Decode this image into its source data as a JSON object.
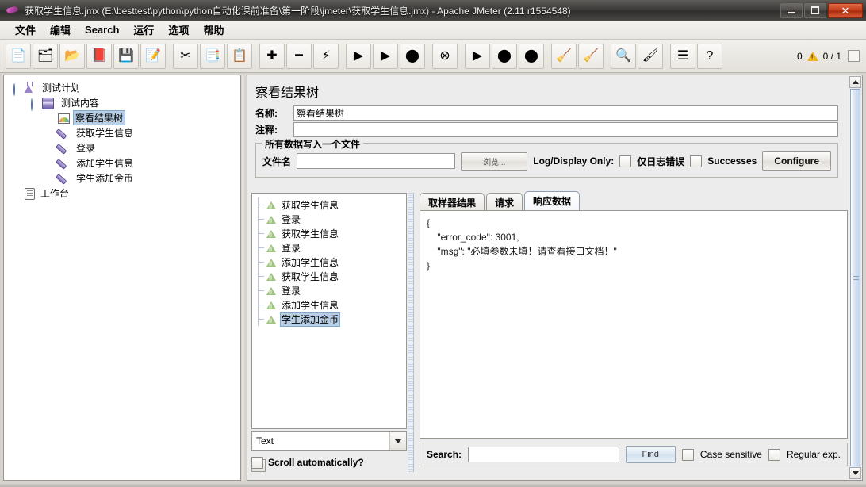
{
  "window": {
    "title": "获取学生信息.jmx (E:\\besttest\\python\\python自动化课前准备\\第一阶段\\jmeter\\获取学生信息.jmx) - Apache JMeter (2.11 r1554548)",
    "minimize_label": "—",
    "maximize_label": "□",
    "close_label": "✕"
  },
  "menubar": {
    "items": [
      {
        "label": "文件",
        "name": "menu-file"
      },
      {
        "label": "编辑",
        "name": "menu-edit"
      },
      {
        "label": "Search",
        "name": "menu-search"
      },
      {
        "label": "运行",
        "name": "menu-run"
      },
      {
        "label": "选项",
        "name": "menu-options"
      },
      {
        "label": "帮助",
        "name": "menu-help"
      }
    ]
  },
  "toolbar": {
    "buttons": [
      {
        "icon": "new-file-icon",
        "glyph": "📄"
      },
      {
        "icon": "templates-icon",
        "glyph": "🗂"
      },
      {
        "icon": "open-icon",
        "glyph": "📂"
      },
      {
        "icon": "close-icon",
        "glyph": "📕"
      },
      {
        "icon": "save-icon",
        "glyph": "💾"
      },
      {
        "icon": "save-as-icon",
        "glyph": "📝"
      },
      {
        "icon": "cut-icon",
        "glyph": "✂"
      },
      {
        "icon": "copy-icon",
        "glyph": "📑"
      },
      {
        "icon": "paste-icon",
        "glyph": "📋"
      },
      {
        "icon": "expand-icon",
        "glyph": "✚"
      },
      {
        "icon": "collapse-icon",
        "glyph": "━"
      },
      {
        "icon": "toggle-icon",
        "glyph": "⚡"
      },
      {
        "icon": "start-icon",
        "glyph": "▶"
      },
      {
        "icon": "start-no-pauses-icon",
        "glyph": "▶"
      },
      {
        "icon": "stop-icon",
        "glyph": "⬤"
      },
      {
        "icon": "shutdown-icon",
        "glyph": "⊗"
      },
      {
        "icon": "remote-start-icon",
        "glyph": "▶"
      },
      {
        "icon": "remote-stop-icon",
        "glyph": "⬤"
      },
      {
        "icon": "remote-shutdown-icon",
        "glyph": "⬤"
      },
      {
        "icon": "clear-icon",
        "glyph": "🧹"
      },
      {
        "icon": "clear-all-icon",
        "glyph": "🧹"
      },
      {
        "icon": "search-icon",
        "glyph": "🔍"
      },
      {
        "icon": "search-reset-icon",
        "glyph": "🖌"
      },
      {
        "icon": "function-helper-icon",
        "glyph": "☰"
      },
      {
        "icon": "help-icon",
        "glyph": "?"
      }
    ],
    "error_count": "0",
    "thread_count": "0 / 1"
  },
  "tree": {
    "nodes": [
      {
        "label": "测试计划",
        "icon": "test-plan-icon",
        "indent": 0,
        "selected": false,
        "name": "tree-node-test-plan"
      },
      {
        "label": "测试内容",
        "icon": "thread-group-icon",
        "indent": 1,
        "selected": false,
        "name": "tree-node-thread-group"
      },
      {
        "label": "察看结果树",
        "icon": "view-results-tree-icon",
        "indent": 2,
        "selected": true,
        "name": "tree-node-view-results-tree"
      },
      {
        "label": "获取学生信息",
        "icon": "http-sampler-icon",
        "indent": 2,
        "selected": false,
        "name": "tree-node-get-student-info"
      },
      {
        "label": "登录",
        "icon": "http-sampler-icon",
        "indent": 2,
        "selected": false,
        "name": "tree-node-login"
      },
      {
        "label": "添加学生信息",
        "icon": "http-sampler-icon",
        "indent": 2,
        "selected": false,
        "name": "tree-node-add-student-info"
      },
      {
        "label": "学生添加金币",
        "icon": "http-sampler-icon",
        "indent": 2,
        "selected": false,
        "name": "tree-node-add-gold"
      },
      {
        "label": "工作台",
        "icon": "workbench-icon",
        "indent": 0,
        "selected": false,
        "name": "tree-node-workbench"
      }
    ]
  },
  "panel": {
    "heading": "察看结果树",
    "name_label": "名称:",
    "name_value": "察看结果树",
    "comment_label": "注释:",
    "comment_value": "",
    "group_title": "所有数据写入一个文件",
    "filename_label": "文件名",
    "filename_value": "",
    "browse_label": "浏览...",
    "log_display_only_label": "Log/Display Only:",
    "errors_only_label": "仅日志错误",
    "successes_label": "Successes",
    "configure_label": "Configure"
  },
  "results": {
    "items": [
      {
        "label": "获取学生信息",
        "status": "success",
        "selected": false
      },
      {
        "label": "登录",
        "status": "success",
        "selected": false
      },
      {
        "label": "获取学生信息",
        "status": "success",
        "selected": false
      },
      {
        "label": "登录",
        "status": "success",
        "selected": false
      },
      {
        "label": "添加学生信息",
        "status": "success",
        "selected": false
      },
      {
        "label": "获取学生信息",
        "status": "success",
        "selected": false
      },
      {
        "label": "登录",
        "status": "success",
        "selected": false
      },
      {
        "label": "添加学生信息",
        "status": "success",
        "selected": false
      },
      {
        "label": "学生添加金币",
        "status": "success",
        "selected": true
      }
    ],
    "renderer_selected": "Text",
    "scroll_automatically_label": "Scroll automatically?"
  },
  "detail": {
    "tabs": [
      {
        "label": "取样器结果",
        "active": false,
        "name": "tab-sampler-result"
      },
      {
        "label": "请求",
        "active": false,
        "name": "tab-request"
      },
      {
        "label": "响应数据",
        "active": true,
        "name": "tab-response-data"
      }
    ],
    "response_body": "{\n    \"error_code\": 3001,\n    \"msg\": \"必填参数未填！请查看接口文档！\"\n}",
    "search_label": "Search:",
    "search_value": "",
    "find_label": "Find",
    "case_sensitive_label": "Case sensitive",
    "regular_exp_label": "Regular exp."
  },
  "colors": {
    "selection": "#b8cfe5",
    "title_bar": "#3d3b39",
    "close_button": "#c33a18",
    "warning": "#f0b323",
    "panel_bg": "#ececec"
  }
}
